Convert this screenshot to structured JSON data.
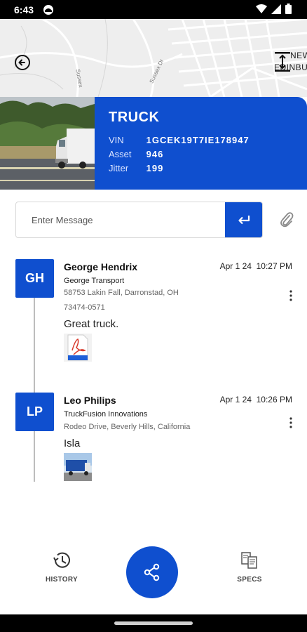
{
  "status_bar": {
    "time": "6:43"
  },
  "map": {
    "street_name": "Sussex Dr",
    "street_name_2": "Sussex",
    "place_label_line1": "NEW",
    "place_label_line2": "EDINBU"
  },
  "truck": {
    "title": "TRUCK",
    "rows": [
      {
        "key": "VIN",
        "value": "1GCEK19T7IE178947"
      },
      {
        "key": "Asset",
        "value": "946"
      },
      {
        "key": "Jitter",
        "value": "199"
      }
    ]
  },
  "message": {
    "placeholder": "Enter Message"
  },
  "entries": [
    {
      "initials": "GH",
      "name": "George Hendrix",
      "date": "Apr 1 24",
      "time": "10:27 PM",
      "company": "George Transport",
      "address_line1": "58753 Lakin Fall, Darronstad, OH",
      "address_line2": "73474-0571",
      "message": "Great truck.",
      "attachment": "pdf-attachment"
    },
    {
      "initials": "LP",
      "name": "Leo Philips",
      "date": "Apr 1 24",
      "time": "10:26 PM",
      "company": "TruckFusion Innovations",
      "address_line1": "Rodeo Drive, Beverly Hills, California",
      "message": "Isla",
      "attachment": "image-attachment"
    }
  ],
  "nav": {
    "history_label": "HISTORY",
    "specs_label": "SPECS",
    "share_icon": "share-icon"
  },
  "colors": {
    "primary": "#0f4fcf",
    "status_bar": "#000000",
    "map_bg": "#eeeeee"
  }
}
